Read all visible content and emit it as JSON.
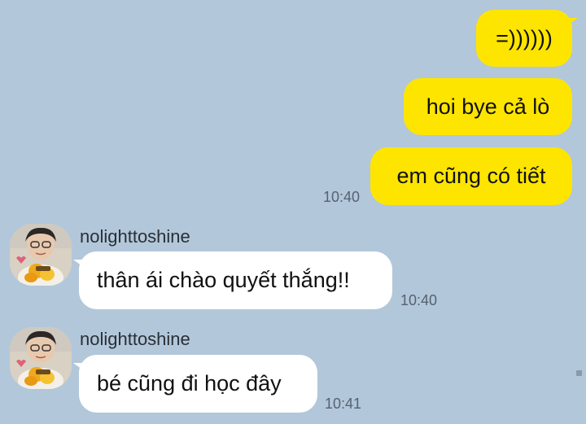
{
  "messages": {
    "out1": "=))))))",
    "out2": "hoi bye cả lò",
    "out3": "em cũng có tiết",
    "out3_time": "10:40",
    "in1_sender": "nolighttoshine",
    "in1_text": "thân ái chào quyết thắng!!",
    "in1_time": "10:40",
    "in2_sender": "nolighttoshine",
    "in2_text": "bé cũng đi học đây",
    "in2_time": "10:41"
  },
  "colors": {
    "background": "#b2c7da",
    "outgoing_bubble": "#fee500",
    "incoming_bubble": "#ffffff"
  },
  "icons": {
    "avatar": "profile-photo-avatar",
    "scroll": "scroll-indicator"
  }
}
